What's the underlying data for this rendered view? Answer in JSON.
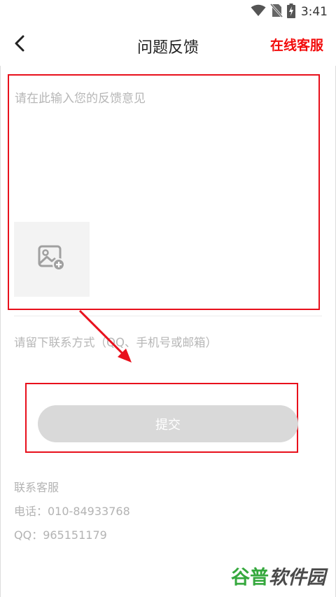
{
  "status_bar": {
    "time": "3:41",
    "icons": [
      "wifi-icon",
      "no-sim-icon",
      "battery-charging-icon"
    ]
  },
  "header": {
    "back_icon": "chevron-left-icon",
    "title": "问题反馈",
    "online_service_label": "在线客服"
  },
  "feedback": {
    "placeholder": "请在此输入您的反馈意见",
    "value": "",
    "add_image_icon": "image-add-icon"
  },
  "contact": {
    "placeholder": "请留下联系方式（QQ、手机号或邮箱）",
    "value": ""
  },
  "submit": {
    "label": "提交"
  },
  "contact_info": {
    "title": "联系客服",
    "phone": "电话：010-84933768",
    "qq": "QQ：965151179"
  },
  "watermark": {
    "part1": "谷普",
    "part2": "软件园"
  },
  "colors": {
    "accent_red": "#f20c0c",
    "highlight_border": "#e8101c",
    "submit_disabled": "#d9d9d9",
    "placeholder": "#b7b7b7"
  }
}
